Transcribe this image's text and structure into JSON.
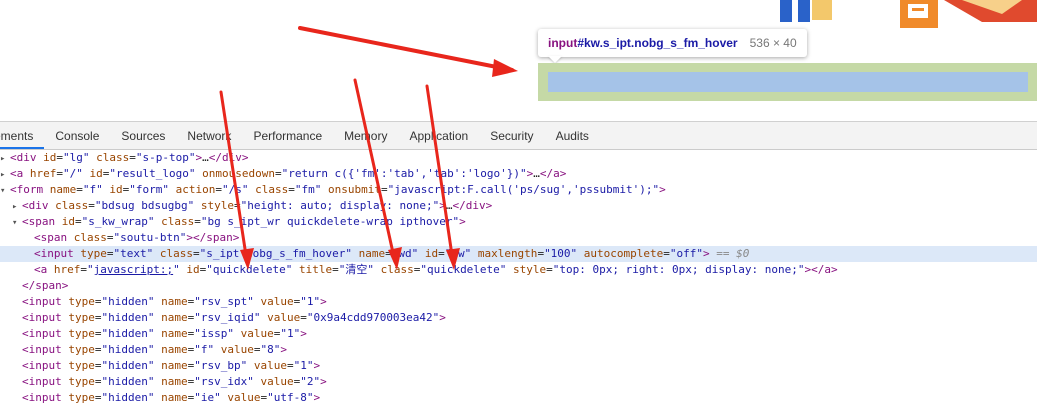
{
  "tooltip": {
    "tag": "input",
    "selector": "#kw.s_ipt.nobg_s_fm_hover",
    "size": "536 × 40"
  },
  "devtools": {
    "tabs": [
      "ements",
      "Console",
      "Sources",
      "Network",
      "Performance",
      "Memory",
      "Application",
      "Security",
      "Audits"
    ],
    "active_tab": "ements"
  },
  "dom_lines": [
    {
      "text": "<div id=\"lg\" class=\"s-p-top\">…</div>"
    },
    {
      "text": "<a href=\"/\" id=\"result_logo\" onmousedown=\"return c({'fm':'tab','tab':'logo'})\">…</a>"
    },
    {
      "text": "<form name=\"f\" id=\"form\" action=\"/s\" class=\"fm\" onsubmit=\"javascript:F.call('ps/sug','pssubmit');\">"
    },
    {
      "text": "<div class=\"bdsug bdsugbg\" style=\"height: auto; display: none;\">…</div>"
    },
    {
      "text": "<span id=\"s_kw_wrap\" class=\"bg s_ipt_wr quickdelete-wrap ipthover\">"
    },
    {
      "text": "<span class=\"soutu-btn\"></span>"
    },
    {
      "text": "<input type=\"text\" class=\"s_ipt nobg_s_fm_hover\" name=\"wd\" id=\"kw\" maxlength=\"100\" autocomplete=\"off\"> == $0"
    },
    {
      "text": "<a href=\"javascript:;\" id=\"quickdelete\" title=\"清空\" class=\"quickdelete\" style=\"top: 0px; right: 0px; display: none;\"></a>"
    },
    {
      "text": "</span>"
    },
    {
      "text": "<input type=\"hidden\" name=\"rsv_spt\" value=\"1\">"
    },
    {
      "text": "<input type=\"hidden\" name=\"rsv_iqid\" value=\"0x9a4cdd970003ea42\">"
    },
    {
      "text": "<input type=\"hidden\" name=\"issp\" value=\"1\">"
    },
    {
      "text": "<input type=\"hidden\" name=\"f\" value=\"8\">"
    },
    {
      "text": "<input type=\"hidden\" name=\"rsv_bp\" value=\"1\">"
    },
    {
      "text": "<input type=\"hidden\" name=\"rsv_idx\" value=\"2\">"
    },
    {
      "text": "<input type=\"hidden\" name=\"ie\" value=\"utf-8\">"
    }
  ],
  "colors": {
    "tag": "#881280",
    "attr_name": "#994500",
    "attr_value": "#1a1aa6",
    "selection": "#dce8f8",
    "highlight_margin": "#c5d9a6",
    "highlight_content": "#a5c3e8",
    "arrow": "#e8261c"
  }
}
